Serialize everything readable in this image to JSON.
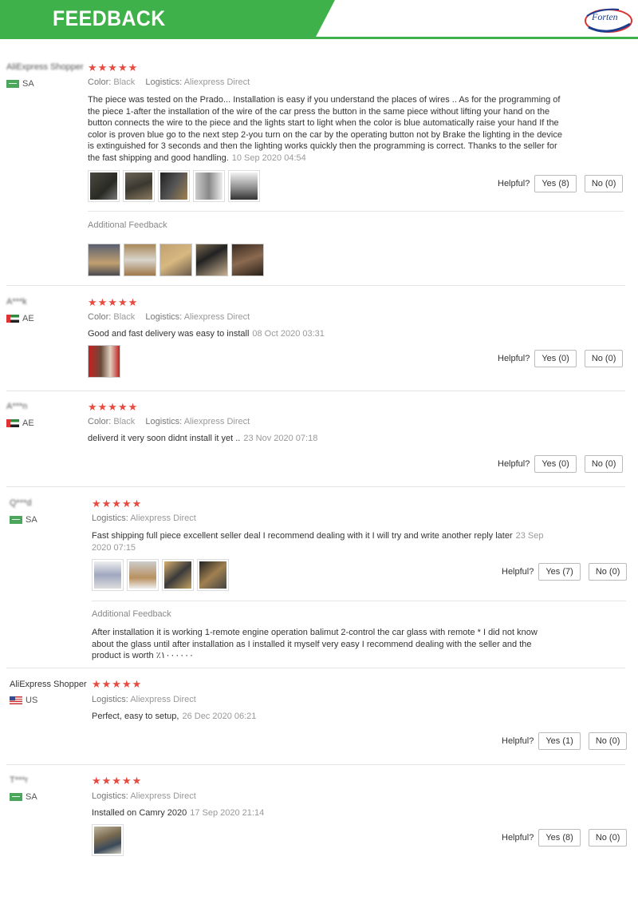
{
  "banner": {
    "title": "FEEDBACK",
    "logo_text": "Forten",
    "color": "#3fb14a"
  },
  "helpful_label": "Helpful?",
  "reviews": [
    {
      "user": "AliExpress Shopper",
      "country": "SA",
      "color_label": "Color:",
      "color_value": "Black",
      "logistics_label": "Logistics:",
      "logistics_value": "Aliexpress Direct",
      "text": "The piece was tested on the Prado... Installation is easy if you understand the places of wires .. As for the programming of the piece 1-after the installation of the wire of the car press the button in the same piece without lifting your hand on the button connects the wire to the piece and the lights start to light when the color is blue automatically raise your hand If the color is proven blue go to the next step 2-you turn on the car by the operating button not by Brake the lighting in the device is extinguished for 3 seconds and then the lighting works quickly then the programming is correct. Thanks to the seller for the fast shipping and good handling.",
      "date": "10 Sep 2020 04:54",
      "yes": "Yes (8)",
      "no": "No (0)",
      "additional_label": "Additional Feedback"
    },
    {
      "user": "A***k",
      "country": "AE",
      "color_label": "Color:",
      "color_value": "Black",
      "logistics_label": "Logistics:",
      "logistics_value": "Aliexpress Direct",
      "text": "Good and fast delivery was easy to install",
      "date": "08 Oct 2020 03:31",
      "yes": "Yes (0)",
      "no": "No (0)"
    },
    {
      "user": "A***n",
      "country": "AE",
      "color_label": "Color:",
      "color_value": "Black",
      "logistics_label": "Logistics:",
      "logistics_value": "Aliexpress Direct",
      "text": "deliverd it very soon didnt install it yet ..",
      "date": "23 Nov 2020 07:18",
      "yes": "Yes (0)",
      "no": "No (0)"
    },
    {
      "user": "Q***d",
      "country": "SA",
      "logistics_label": "Logistics:",
      "logistics_value": "Aliexpress Direct",
      "text": "Fast shipping full piece excellent seller deal I recommend dealing with it I will try and write another reply later",
      "date": "23 Sep 2020 07:15",
      "yes": "Yes (7)",
      "no": "No (0)",
      "additional_label": "Additional Feedback",
      "additional_text": "After installation it is working 1-remote engine operation balimut 2-control the car glass with remote * I did not know about the glass until after installation as I installed it myself very easy I recommend dealing with the seller and the product is worth ٪١٠٠٠٠٠٠"
    },
    {
      "user": "AliExpress Shopper",
      "country": "US",
      "logistics_label": "Logistics:",
      "logistics_value": "Aliexpress Direct",
      "text": "Perfect, easy to setup,",
      "date": "26 Dec 2020 06:21",
      "yes": "Yes (1)",
      "no": "No (0)"
    },
    {
      "user": "T***r",
      "country": "SA",
      "logistics_label": "Logistics:",
      "logistics_value": "Aliexpress Direct",
      "text": "Installed on Camry 2020",
      "date": "17 Sep 2020 21:14",
      "yes": "Yes (8)",
      "no": "No (0)"
    }
  ],
  "stars": "★★★★★",
  "colors": {
    "star": "#e84a3f",
    "divider": "#e5e5e5"
  }
}
